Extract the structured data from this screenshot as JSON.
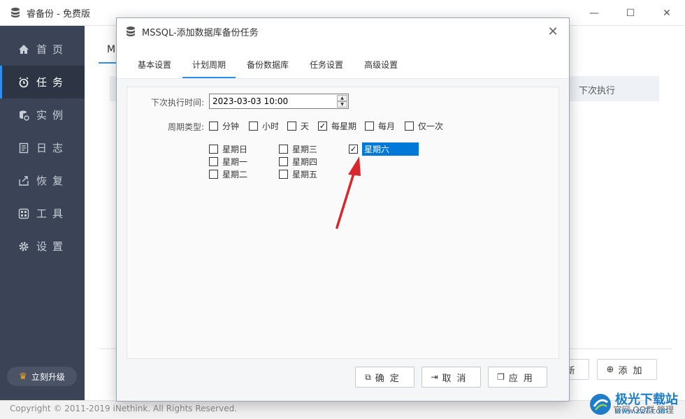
{
  "window": {
    "title": "睿备份 - 免费版",
    "minimize": "—",
    "maximize": "☐",
    "close": "✕"
  },
  "sidebar": {
    "items": [
      {
        "label": "首页",
        "icon": "home-icon"
      },
      {
        "label": "任务",
        "icon": "alarm-clock-icon"
      },
      {
        "label": "实例",
        "icon": "database-icon"
      },
      {
        "label": "日志",
        "icon": "log-icon"
      },
      {
        "label": "恢复",
        "icon": "restore-icon"
      },
      {
        "label": "工具",
        "icon": "tools-icon"
      },
      {
        "label": "设置",
        "icon": "gear-icon"
      }
    ],
    "upgrade_label": "立刻升级"
  },
  "main": {
    "tab_label": "M",
    "thead_next": "下次执行",
    "new_button": "新",
    "add_button": "添加"
  },
  "statusbar": {
    "copyright": "Copyright © 2011-2019 iNethink. All Rights Reserved.",
    "right_text": "官网   QQ群   管理"
  },
  "dialog": {
    "title": "MSSQL-添加数据库备份任务",
    "close": "✕",
    "tabs": [
      "基本设置",
      "计划周期",
      "备份数据库",
      "任务设置",
      "高级设置"
    ],
    "active_tab": "计划周期",
    "next_time_label": "下次执行时间:",
    "next_time_value": "2023-03-03 10:00",
    "period_type_label": "周期类型:",
    "period_types": [
      {
        "label": "分钟",
        "checked": false
      },
      {
        "label": "小时",
        "checked": false
      },
      {
        "label": "天",
        "checked": false
      },
      {
        "label": "每星期",
        "checked": true
      },
      {
        "label": "每月",
        "checked": false
      },
      {
        "label": "仅一次",
        "checked": false
      }
    ],
    "weekdays": [
      {
        "label": "星期日",
        "checked": false
      },
      {
        "label": "星期一",
        "checked": false
      },
      {
        "label": "星期二",
        "checked": false
      },
      {
        "label": "星期三",
        "checked": false
      },
      {
        "label": "星期四",
        "checked": false
      },
      {
        "label": "星期五",
        "checked": false
      },
      {
        "label": "星期六",
        "checked": true,
        "selected": true
      }
    ],
    "buttons": {
      "ok": "确定",
      "cancel": "取消",
      "apply": "应用"
    }
  },
  "watermark": {
    "main": "极光下载站",
    "sub": "www.xz7.com"
  },
  "colors": {
    "accent": "#2f8ff0",
    "sidebar_bg": "#3a4456",
    "selection": "#0078d7",
    "arrow": "#d9262c"
  }
}
